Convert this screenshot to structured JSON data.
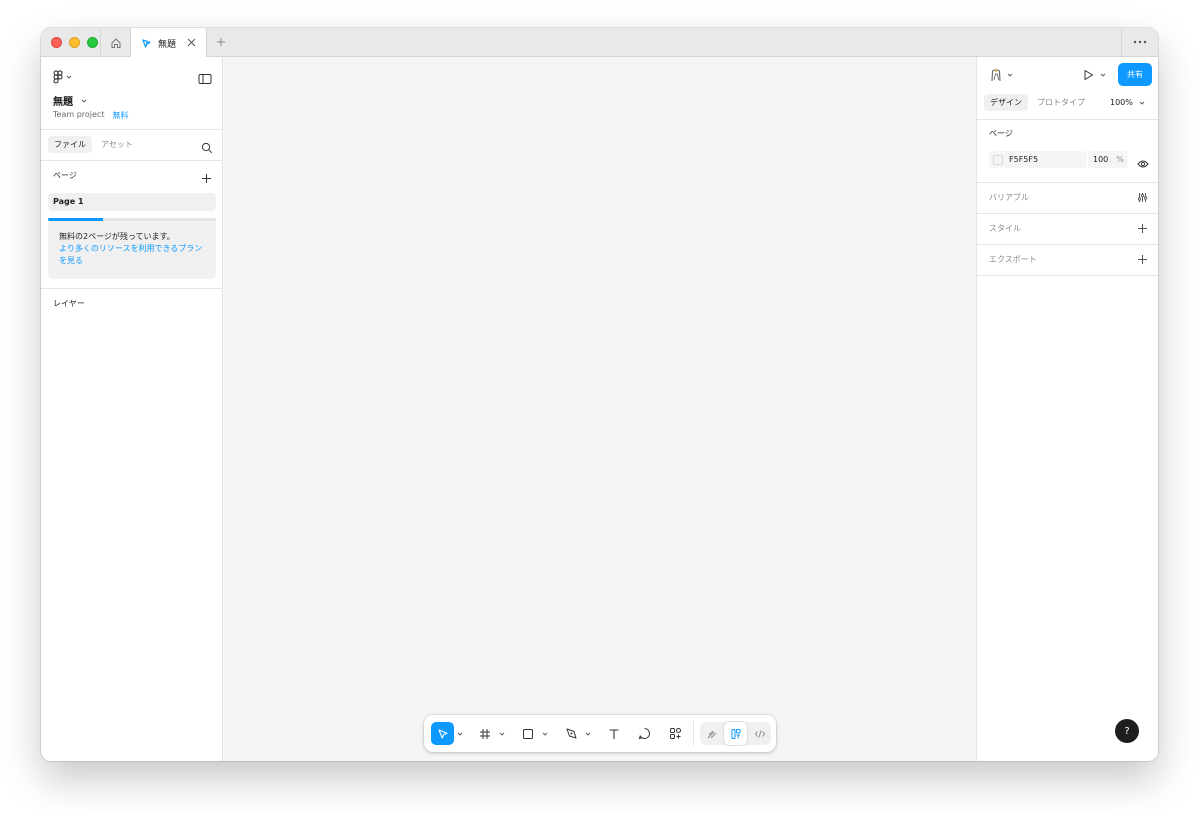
{
  "titlebar": {
    "tab_title": "無題",
    "icons": [
      "home-icon",
      "close-icon",
      "plus-icon",
      "more-icon"
    ]
  },
  "left": {
    "file_title": "無題",
    "project": "Team project",
    "plan": "無料",
    "tabs": {
      "files": "ファイル",
      "assets": "アセット"
    },
    "pages_label": "ページ",
    "pages": [
      {
        "label": "Page 1"
      }
    ],
    "page_limit_progress": 0.33,
    "upsell": {
      "text": "無料の2ページが残っています。",
      "link": "より多くのリソースを利用できるプランを見る"
    },
    "layers_label": "レイヤー"
  },
  "right": {
    "share_label": "共有",
    "tabs": {
      "design": "デザイン",
      "prototype": "プロトタイプ"
    },
    "zoom": "100%",
    "page_section": "ページ",
    "background": {
      "hex": "F5F5F5",
      "opacity": "100",
      "unit": "%"
    },
    "variables": "バリアブル",
    "styles": "スタイル",
    "export": "エクスポート"
  },
  "help_label": "?",
  "colors": {
    "accent": "#0d99ff",
    "canvas": "#f5f5f5"
  }
}
